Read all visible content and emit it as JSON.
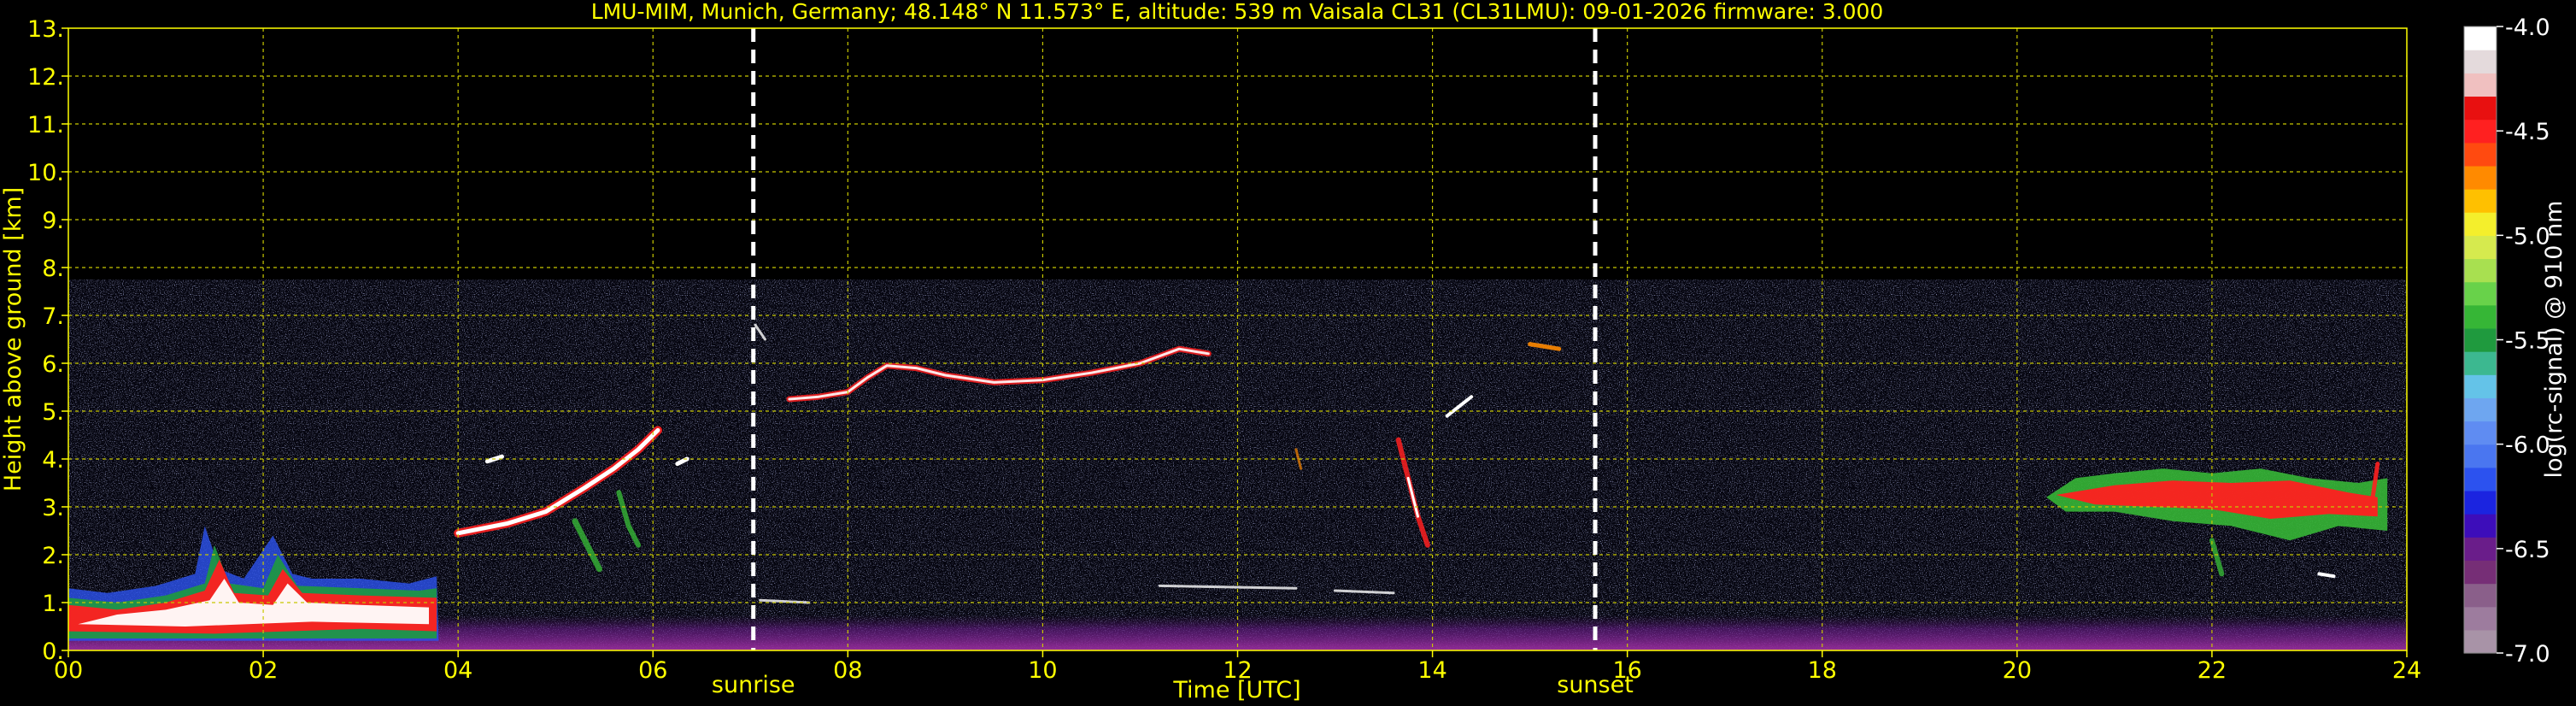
{
  "chart_data": {
    "type": "heatmap",
    "title": "LMU-MIM, Munich, Germany; 48.148° N 11.573° E, altitude: 539 m    Vaisala CL31 (CL31LMU): 09-01-2026    firmware: 3.000",
    "xlabel": "Time [UTC]",
    "ylabel": "Height above ground [km]",
    "xlim": [
      0,
      24
    ],
    "ylim": [
      0,
      13
    ],
    "x_ticks": [
      "00",
      "02",
      "04",
      "06",
      "08",
      "10",
      "12",
      "14",
      "16",
      "18",
      "20",
      "22",
      "24"
    ],
    "y_ticks": [
      "0.",
      "1.",
      "2.",
      "3.",
      "4.",
      "5.",
      "6.",
      "7.",
      "8.",
      "9.",
      "10.",
      "11.",
      "12.",
      "13."
    ],
    "grid": true,
    "valid_height_max_km": 7.75,
    "annotations": [
      {
        "label": "sunrise",
        "x": 7.03
      },
      {
        "label": "sunset",
        "x": 15.67
      }
    ],
    "colorbar": {
      "label": "log(rc-signal) @ 910 nm",
      "range": [
        -7.0,
        -4.0
      ],
      "ticks": [
        "-4.0",
        "-4.5",
        "-5.0",
        "-5.5",
        "-6.0",
        "-6.5",
        "-7.0"
      ],
      "colors": [
        "#a893a7",
        "#9d7c9e",
        "#8a5f8a",
        "#762e76",
        "#6a1d8a",
        "#3d0dba",
        "#1b24e0",
        "#2c52ef",
        "#4a76f0",
        "#5f8cf2",
        "#6ea6f0",
        "#64c3e8",
        "#3cb890",
        "#1f9a3e",
        "#36b636",
        "#68d24a",
        "#a8e050",
        "#d6ea4e",
        "#f4ef2c",
        "#ffc000",
        "#ff8a00",
        "#ff4a10",
        "#ff2020",
        "#e81010",
        "#f0c0c0",
        "#e4dadc",
        "#ffffff"
      ]
    },
    "features": [
      {
        "name": "low-cloud-layer",
        "x_range": [
          0,
          3.8
        ],
        "height_km": [
          0.4,
          1.0
        ]
      },
      {
        "name": "aerosol-boundary-layer",
        "x_range": [
          0,
          24
        ],
        "height_km": [
          0,
          0.6
        ]
      },
      {
        "name": "cirrus-layer",
        "x_range": [
          7.3,
          15.6
        ],
        "height_km": [
          4.8,
          6.4
        ]
      },
      {
        "name": "rising-layer",
        "x_range": [
          3.9,
          6.1
        ],
        "height_km": [
          2.4,
          4.8
        ]
      },
      {
        "name": "mid-cloud-layer",
        "x_range": [
          20.2,
          23.8
        ],
        "height_km": [
          2.6,
          3.9
        ]
      }
    ]
  }
}
